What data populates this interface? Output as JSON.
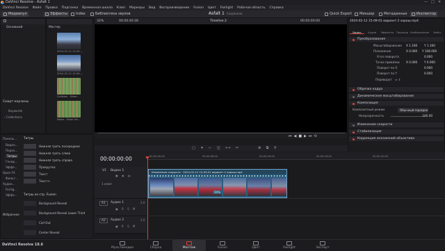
{
  "app": {
    "title": "DaVinci Resolve - Asfalt 1",
    "project": "Asfalt 1",
    "project_status": "Сохранено",
    "version": "DaVinci Resolve 18.6"
  },
  "menu": [
    "DaVinci Resolve",
    "Файл",
    "Правка",
    "Подгонка",
    "Временная шкала",
    "Клип",
    "Маркеры",
    "Вид",
    "Воспроизведение",
    "Fusion",
    "Цвет",
    "Fairlight",
    "Рабочая область",
    "Справка"
  ],
  "toolbar": {
    "media_pool": "Медиапул",
    "effects": "Эффекты",
    "index": "Index",
    "sound_library": "Библиотека звуков",
    "quick_export": "Quick Export",
    "mixer": "Микшер",
    "metadata": "Метаданные",
    "inspector": "Инспектор"
  },
  "viewer_bar": {
    "zoom": "32%",
    "source_timecode": "00:00:40:36",
    "timeline_name": "Timeline 2",
    "record_timecode": "00:00:00:00"
  },
  "media_pool": {
    "left_tab": "Основной",
    "master": "Мастер",
    "clips": [
      {
        "name": "2024-02-12 15-09-..."
      },
      {
        "name": "2024-02-12 15-09-..."
      },
      {
        "name": "Collision - Silver..."
      },
      {
        "name": "Noise - Silver Ha..."
      }
    ],
    "smart_bins": "Смарт-корзины",
    "keywords": "Keywords",
    "collections": "Collections"
  },
  "effects": {
    "tree": [
      "Панель...",
      "Видео...",
      "Перех...",
      "Титры",
      "Генер...",
      "Эффе...",
      "Open FX",
      "Фильт...",
      "Аудио...",
      "Fairlig...",
      "Эффе...",
      "Избранное"
    ],
    "titles_header": "Титры",
    "titles": [
      "Нижняя треть посередине",
      "Нижняя треть слева",
      "Нижняя треть справа",
      "Прокрутка",
      "Текст",
      "Текст+"
    ],
    "fusion_header": "Титры из стр. Fusion",
    "fusion_titles": [
      "Background Reveal",
      "Background Reveal Lower Third",
      "Call Out",
      "Center Reveal"
    ]
  },
  "inspector": {
    "clip_name": "2024-02-12 15-09-01 вариант 2 хорош.mp4",
    "tabs": [
      "Видео",
      "Аудио",
      "Эффекты",
      "Переход",
      "Изображение",
      "Файл"
    ],
    "transform": "Преобразование",
    "rows": [
      {
        "label": "Масштабирование",
        "x": "X 1.160",
        "y": "Y 1.160"
      },
      {
        "label": "Положение",
        "x": "X 0.000",
        "y": "Y 108.000"
      },
      {
        "label": "Угол поворота",
        "v": "0.000"
      },
      {
        "label": "Точка привязки",
        "x": "X 0.000",
        "y": "Y 0.000"
      },
      {
        "label": "Поворот по X",
        "v": "0.000"
      },
      {
        "label": "Поворот по Y",
        "v": "0.000"
      },
      {
        "label": "Переворот"
      }
    ],
    "crop": "Обрезка кадра",
    "dyn_zoom": "Динамическое масштабирование",
    "composite": "Композиция",
    "comp_mode_label": "Композитный режим",
    "comp_mode": "Обычный порядок",
    "opacity_label": "Непрозрачность",
    "opacity": "100.00",
    "retime": "Изменение скорости",
    "stabilize": "Стабилизация",
    "lens": "Коррекция искажений объектива"
  },
  "timeline": {
    "timecode": "00:00:00:00",
    "ruler": [
      "00:00:00:00",
      "00:00:08:00",
      "00:00:16:00",
      "00:00:24:00",
      "00:00:32:00"
    ],
    "video_track": "V1",
    "video_name": "Видео 1",
    "video_count": "1 клип",
    "audio1_tag": "A1",
    "audio1_name": "Аудио 1",
    "audio1_ch": "2.0",
    "audio2_tag": "A2",
    "audio2_name": "Аудио 2",
    "audio2_ch": "2.0",
    "clip_label": "Изменение скорости",
    "clip_name": "2024-02-12 15-09-01 вариант 2 хорош.mp4",
    "clip_speed": "50%"
  },
  "pages": [
    "Мультимедиа",
    "Сборка",
    "Монтаж",
    "Fusion",
    "Цвет",
    "Fairlight",
    "Экспорт"
  ],
  "active_page": "Монтаж"
}
